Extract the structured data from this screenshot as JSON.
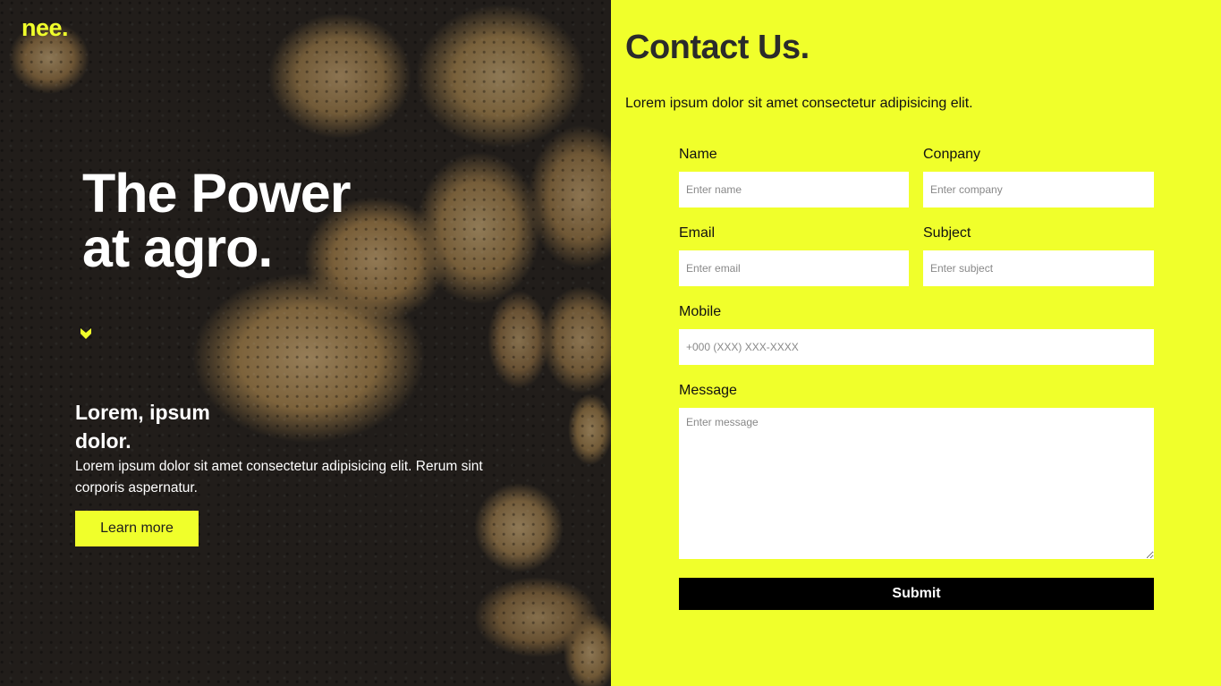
{
  "hero": {
    "logo": "nee.",
    "title_line1": "The Power",
    "title_line2": "at agro.",
    "subtitle_line1": "Lorem, ipsum",
    "subtitle_line2": "dolor.",
    "text": "Lorem ipsum dolor sit amet consectetur adipisicing elit. Rerum sint corporis aspernatur.",
    "button_label": "Learn more",
    "icon": "chevron-down-icon"
  },
  "contact": {
    "title": "Contact Us.",
    "description": "Lorem ipsum dolor sit amet consectetur adipisicing elit.",
    "fields": {
      "name": {
        "label": "Name",
        "placeholder": "Enter name"
      },
      "company": {
        "label": "Conpany",
        "placeholder": "Enter company"
      },
      "email": {
        "label": "Email",
        "placeholder": "Enter email"
      },
      "subject": {
        "label": "Subject",
        "placeholder": "Enter subject"
      },
      "mobile": {
        "label": "Mobile",
        "placeholder": "+000 (XXX) XXX-XXXX"
      },
      "message": {
        "label": "Message",
        "placeholder": "Enter message"
      }
    },
    "submit_label": "Submit"
  },
  "colors": {
    "accent": "#f0ff2b",
    "dark": "#000000",
    "title_text": "#2b2b2b"
  }
}
